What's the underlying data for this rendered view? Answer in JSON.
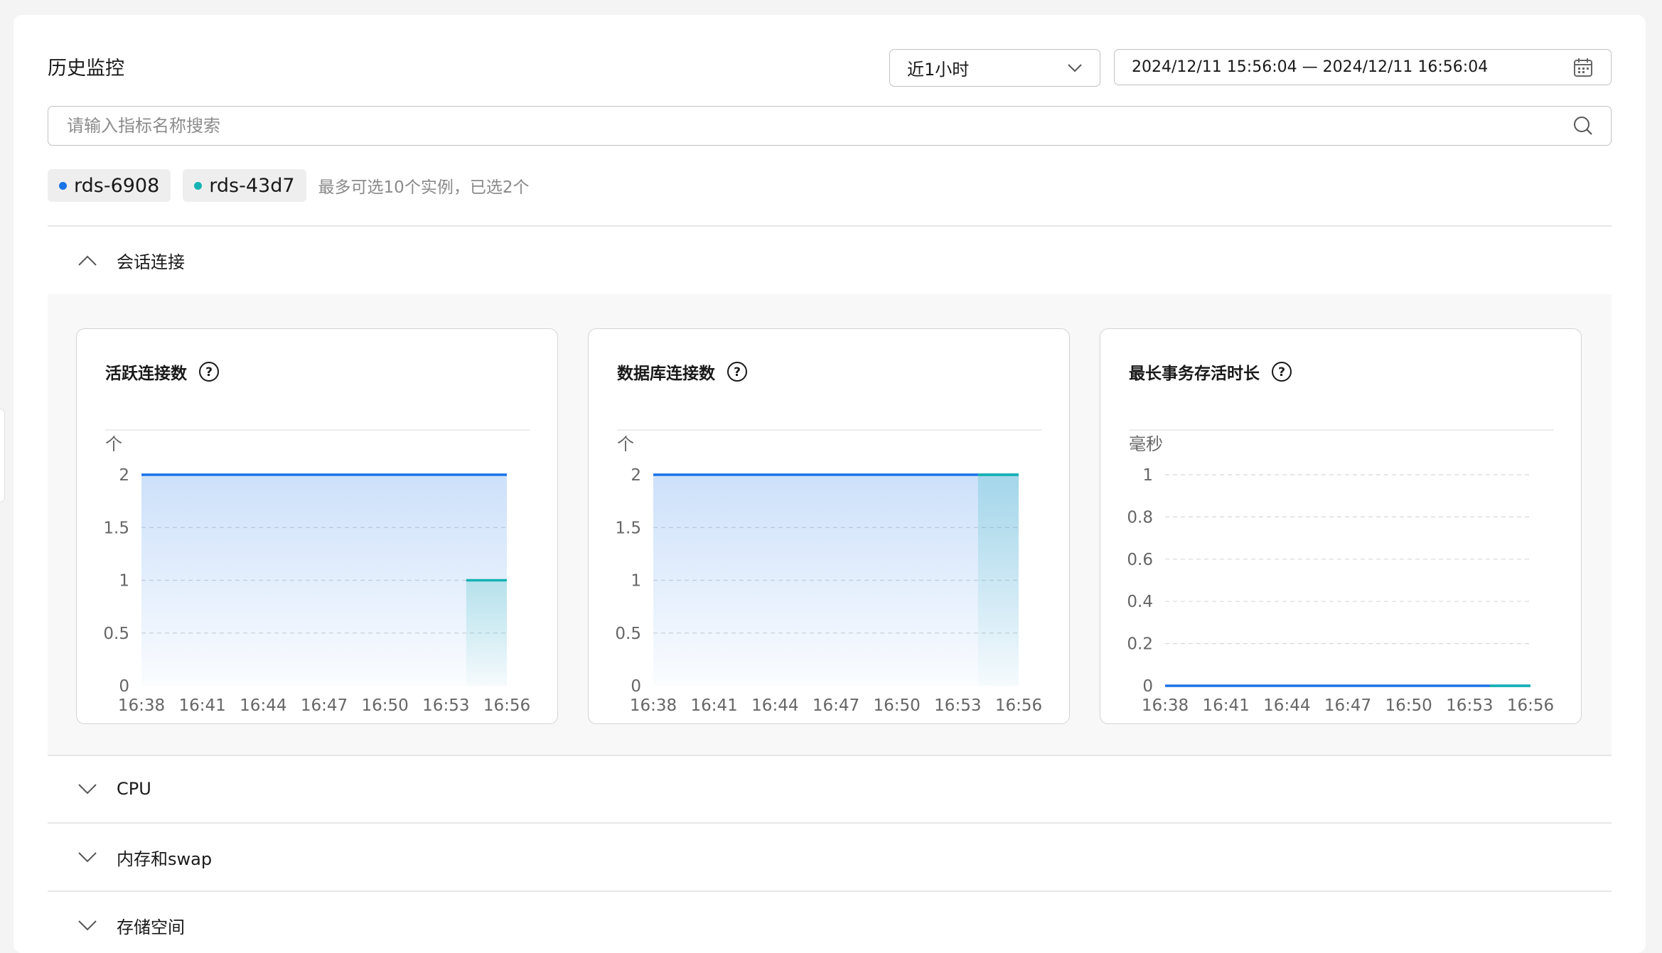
{
  "page": {
    "title": "历史监控",
    "time_select": {
      "value": "近1小时"
    },
    "date_range": {
      "value": "2024/12/11 15:56:04 — 2024/12/11 16:56:04"
    },
    "search": {
      "placeholder": "请输入指标名称搜索",
      "value": ""
    },
    "instances": [
      {
        "label": "rds-6908",
        "color": "#1a73e8"
      },
      {
        "label": "rds-43d7",
        "color": "#15b3b3"
      }
    ],
    "instances_hint": "最多可选10个实例，已选2个"
  },
  "sections": [
    {
      "label": "会话连接",
      "expanded": true
    },
    {
      "label": "CPU",
      "expanded": false
    },
    {
      "label": "内存和swap",
      "expanded": false
    },
    {
      "label": "存储空间",
      "expanded": false
    }
  ],
  "chart_data": [
    {
      "type": "area",
      "title": "活跃连接数",
      "ylabel": "个",
      "ylim": [
        0,
        2
      ],
      "yticks": [
        "0",
        "0.5",
        "1",
        "1.5",
        "2"
      ],
      "x_ticks": [
        "16:38",
        "16:41",
        "16:44",
        "16:47",
        "16:50",
        "16:53",
        "16:56"
      ],
      "xlim": [
        "16:38",
        "16:56"
      ],
      "series": [
        {
          "color": "#1a73e8",
          "x": [
            "16:38",
            "16:56"
          ],
          "values": [
            2,
            2
          ]
        },
        {
          "color": "#15b3b3",
          "x": [
            "16:54",
            "16:56"
          ],
          "values": [
            1,
            1
          ]
        }
      ]
    },
    {
      "type": "area",
      "title": "数据库连接数",
      "ylabel": "个",
      "ylim": [
        0,
        2
      ],
      "yticks": [
        "0",
        "0.5",
        "1",
        "1.5",
        "2"
      ],
      "x_ticks": [
        "16:38",
        "16:41",
        "16:44",
        "16:47",
        "16:50",
        "16:53",
        "16:56"
      ],
      "xlim": [
        "16:38",
        "16:56"
      ],
      "series": [
        {
          "color": "#1a73e8",
          "x": [
            "16:38",
            "16:56"
          ],
          "values": [
            2,
            2
          ]
        },
        {
          "color": "#15b3b3",
          "x": [
            "16:54",
            "16:56"
          ],
          "values": [
            2,
            2
          ]
        }
      ]
    },
    {
      "type": "line",
      "title": "最长事务存活时长",
      "ylabel": "毫秒",
      "ylim": [
        0,
        1
      ],
      "yticks": [
        "0",
        "0.2",
        "0.4",
        "0.6",
        "0.8",
        "1"
      ],
      "x_ticks": [
        "16:38",
        "16:41",
        "16:44",
        "16:47",
        "16:50",
        "16:53",
        "16:56"
      ],
      "xlim": [
        "16:38",
        "16:56"
      ],
      "series": [
        {
          "color": "#1a73e8",
          "x": [
            "16:38",
            "16:56"
          ],
          "values": [
            0,
            0
          ]
        },
        {
          "color": "#15b3b3",
          "x": [
            "16:54",
            "16:56"
          ],
          "values": [
            0,
            0
          ]
        }
      ]
    }
  ]
}
